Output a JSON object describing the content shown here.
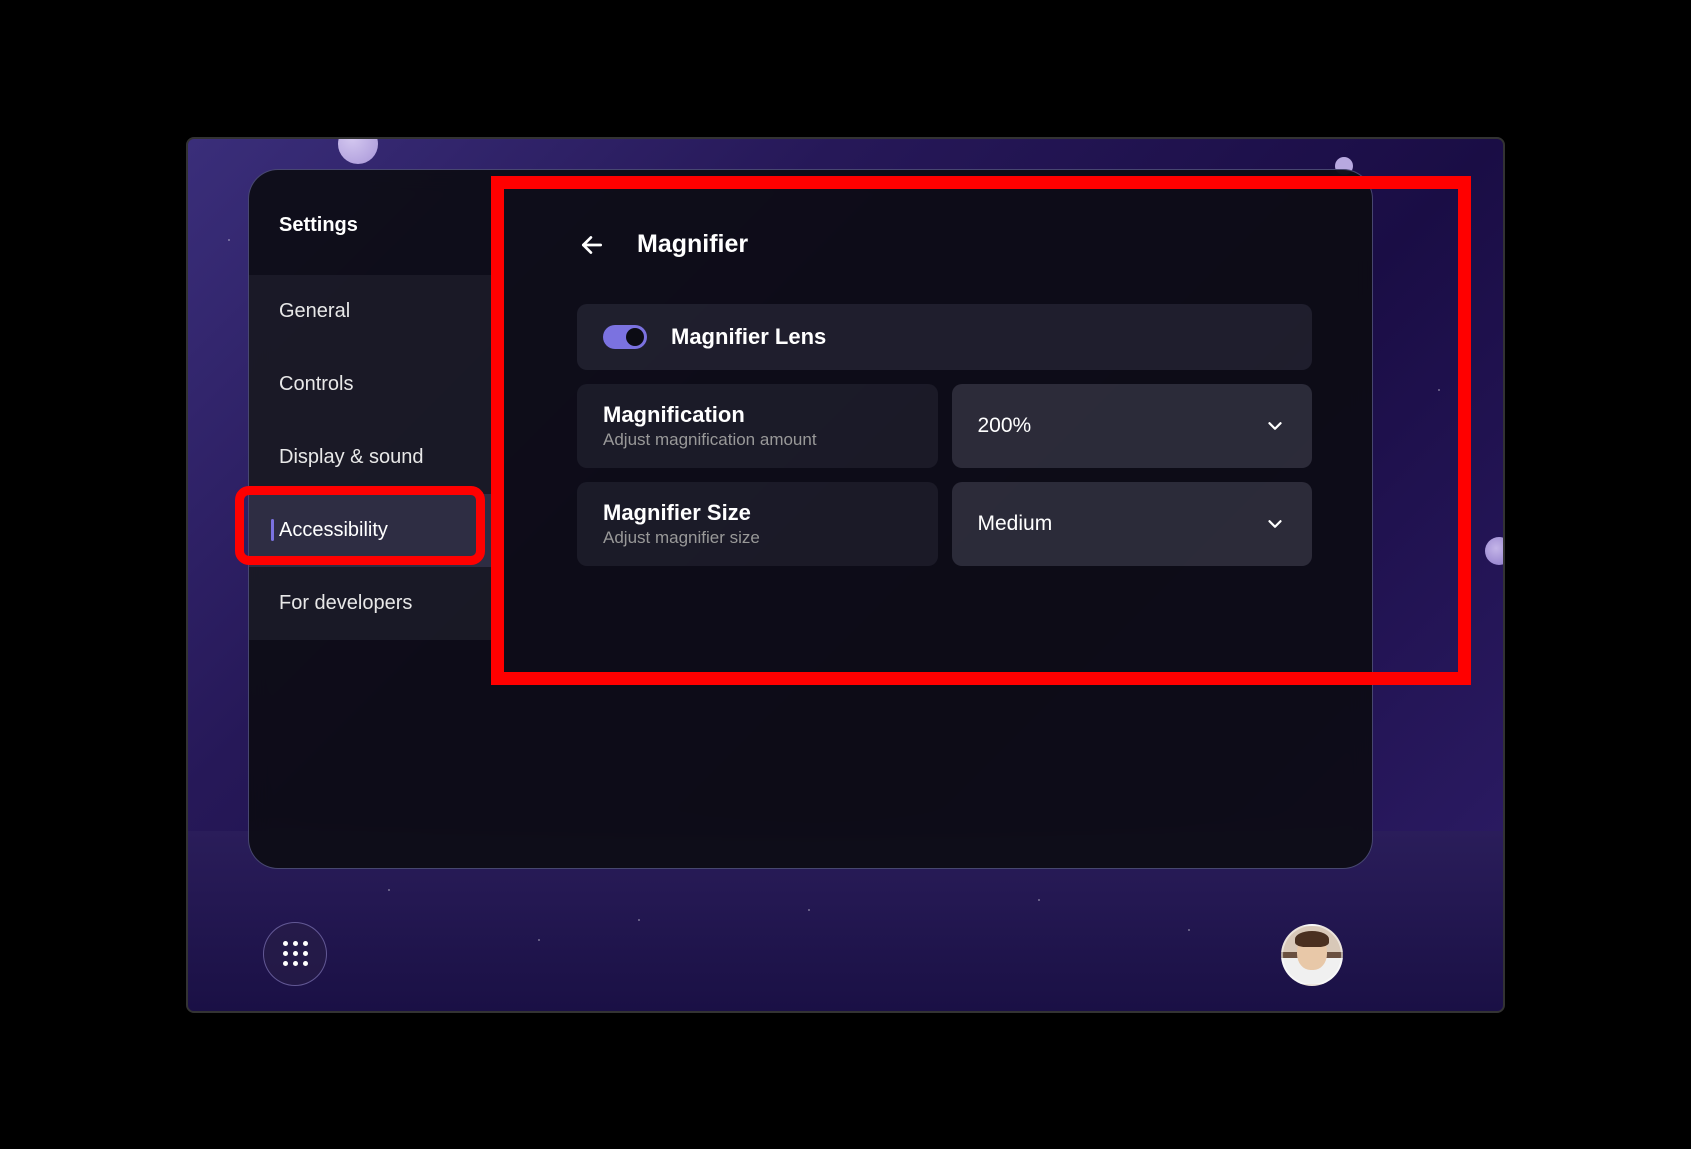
{
  "sidebar": {
    "title": "Settings",
    "items": [
      {
        "label": "General"
      },
      {
        "label": "Controls"
      },
      {
        "label": "Display & sound"
      },
      {
        "label": "Accessibility"
      },
      {
        "label": "For developers"
      }
    ],
    "activeIndex": 3
  },
  "main": {
    "title": "Magnifier",
    "toggle": {
      "label": "Magnifier Lens",
      "enabled": true
    },
    "settings": [
      {
        "title": "Magnification",
        "subtitle": "Adjust magnification amount",
        "value": "200%"
      },
      {
        "title": "Magnifier Size",
        "subtitle": "Adjust magnifier size",
        "value": "Medium"
      }
    ]
  },
  "colors": {
    "accent": "#7b72e0",
    "highlight": "#ff0000"
  }
}
